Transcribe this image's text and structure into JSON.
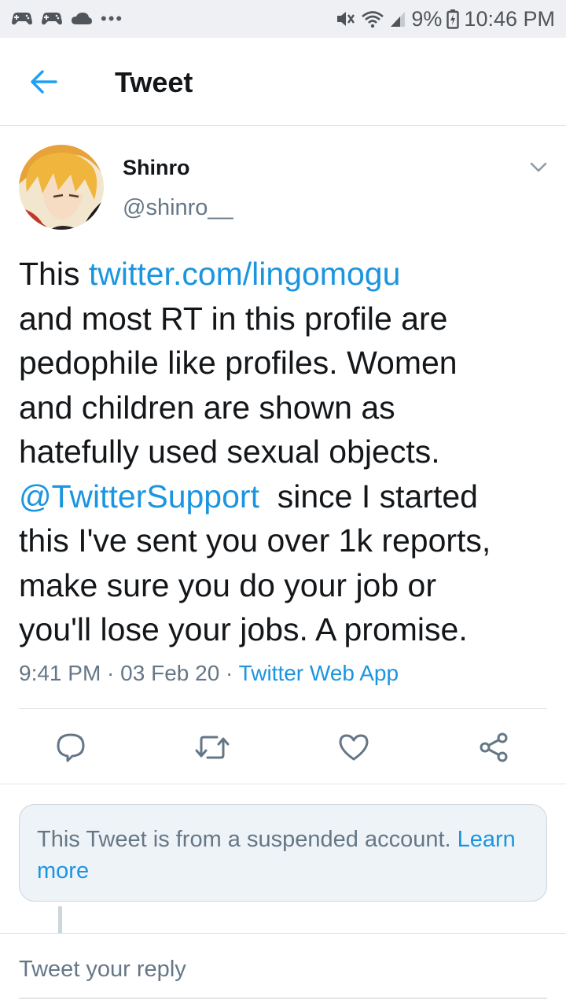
{
  "status_bar": {
    "notification_icons": [
      "game-controller-icon",
      "game-controller-icon",
      "cloud-icon"
    ],
    "more_indicator": "•••",
    "battery": "9%",
    "time": "10:46 PM"
  },
  "header": {
    "title": "Tweet"
  },
  "tweet": {
    "author_name": "Shinro",
    "author_handle": "@shinro__",
    "text_lines": [
      {
        "before": "This ",
        "link": "twitter.com/lingomogu",
        "after": ""
      },
      {
        "before": "and most RT in this profile are",
        "link": "",
        "after": ""
      },
      {
        "before": "pedophile like profiles. Women",
        "link": "",
        "after": ""
      },
      {
        "before": "and children are shown as",
        "link": "",
        "after": ""
      },
      {
        "before": "hatefully used sexual objects.",
        "link": "",
        "after": ""
      },
      {
        "before": "",
        "link": "@TwitterSupport",
        "after": "  since I started"
      },
      {
        "before": "this I've sent you over 1k reports,",
        "link": "",
        "after": ""
      },
      {
        "before": "make sure you do your job or",
        "link": "",
        "after": ""
      },
      {
        "before": "you'll lose your jobs. A promise.",
        "link": "",
        "after": ""
      }
    ],
    "time": "9:41 PM",
    "date": "03 Feb 20",
    "separator": " · ",
    "source": "Twitter Web App"
  },
  "actions": {
    "reply_icon": "reply-icon",
    "retweet_icon": "retweet-icon",
    "like_icon": "heart-icon",
    "share_icon": "share-icon"
  },
  "notice": {
    "text": "This Tweet is from a suspended account. ",
    "link": "Learn more"
  },
  "reply_box": {
    "placeholder": "Tweet your reply"
  },
  "colors": {
    "link": "#1b95e0",
    "secondary_text": "#657786",
    "status_bar_bg": "#eef0f3"
  }
}
